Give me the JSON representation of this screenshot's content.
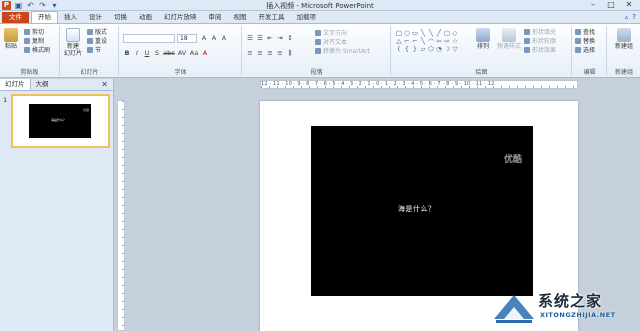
{
  "window": {
    "title": "插入视频 - Microsoft PowerPoint",
    "controls": [
      "–",
      "□",
      "✕"
    ]
  },
  "qat": {
    "icons": [
      "powerpoint-logo-icon",
      "save-icon",
      "undo-icon",
      "redo-icon",
      "customize-icon"
    ],
    "logo_letter": "P",
    "glyphs": [
      "▣",
      "↶",
      "↷",
      "▾"
    ]
  },
  "tabs": [
    "文件",
    "开始",
    "插入",
    "设计",
    "切换",
    "动画",
    "幻灯片放映",
    "审阅",
    "视图",
    "开发工具",
    "加载项"
  ],
  "help_icons": [
    "▵",
    "?"
  ],
  "ribbon": {
    "clipboard": {
      "paste": "粘贴",
      "cut": "剪切",
      "copy": "复制",
      "format_painter": "格式刷",
      "label": "剪贴板"
    },
    "slides": {
      "new_slide": "新建",
      "new_slide_sub": "幻灯片",
      "layout": "版式",
      "reset": "重设",
      "section": "节",
      "label": "幻灯片"
    },
    "font": {
      "size": "18",
      "grow": "A",
      "shrink": "A",
      "clear": "A",
      "label": "字体",
      "formatting": [
        "B",
        "I",
        "U",
        "S",
        "abc",
        "AV",
        "Aa",
        "A"
      ]
    },
    "paragraph": {
      "text_direction": "文字方向",
      "align_text": "对齐文本",
      "smartart": "转换为 SmartArt",
      "label": "段落"
    },
    "drawing": {
      "shapes": [
        "□",
        "○",
        "▭",
        "╲",
        "╲",
        "╱",
        "▢",
        "◇",
        "△",
        "⌐",
        "⌐",
        "╲",
        "◠",
        "⇦",
        "⇨",
        "☆",
        "(",
        "{",
        "}",
        "▱",
        "⬠",
        "◔",
        "☽",
        "▽"
      ],
      "arrange": "排列",
      "quick_styles": "快速样式",
      "shape_fill": "形状填充",
      "shape_outline": "形状轮廓",
      "shape_effects": "形状效果",
      "label": "绘图"
    },
    "editing": {
      "find": "查找",
      "replace": "替换",
      "select": "选择",
      "label": "编辑"
    },
    "new_group": {
      "button": "新建组",
      "label": "新建组"
    }
  },
  "slide_panel": {
    "tabs": [
      "幻灯片",
      "大纲"
    ],
    "close": "✕",
    "slide_number": "1",
    "thumb_text": "海是什么？",
    "thumb_logo": "优酷"
  },
  "ruler": {
    "h_labels": "12 · 11 · 10 · 9 · 8 · 7 · 6 · 5 · 4 · 3 · 2 · 1 · 0 · 1 · 2 · 3 · 4 · 5 · 6 · 7 · 8 · 9 · 10 · 11 · 12"
  },
  "slide": {
    "video_text": "海是什么？",
    "video_logo": "优酷"
  },
  "watermark": {
    "text": "系统之家",
    "url": "XITONGZHIJIA.NET"
  }
}
